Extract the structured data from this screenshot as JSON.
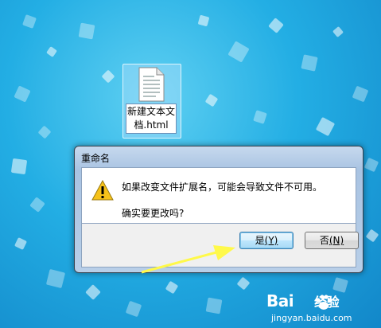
{
  "desktop": {
    "file_icon": {
      "name": "新建文本文档.html"
    }
  },
  "dialog": {
    "title": "重命名",
    "message_line1": "如果改变文件扩展名，可能会导致文件不可用。",
    "message_line2": "确实要更改吗?",
    "yes_label": "是",
    "yes_access": "(Y)",
    "no_label": "否",
    "no_access": "(N)"
  },
  "watermark": {
    "brand": "Bai",
    "brand_suffix": "经验",
    "site": "jingyan.baidu.com"
  },
  "colors": {
    "desktop_background": "#23aee4",
    "dialog_frame": "#b8cfe8",
    "arrow": "#fff94a"
  }
}
